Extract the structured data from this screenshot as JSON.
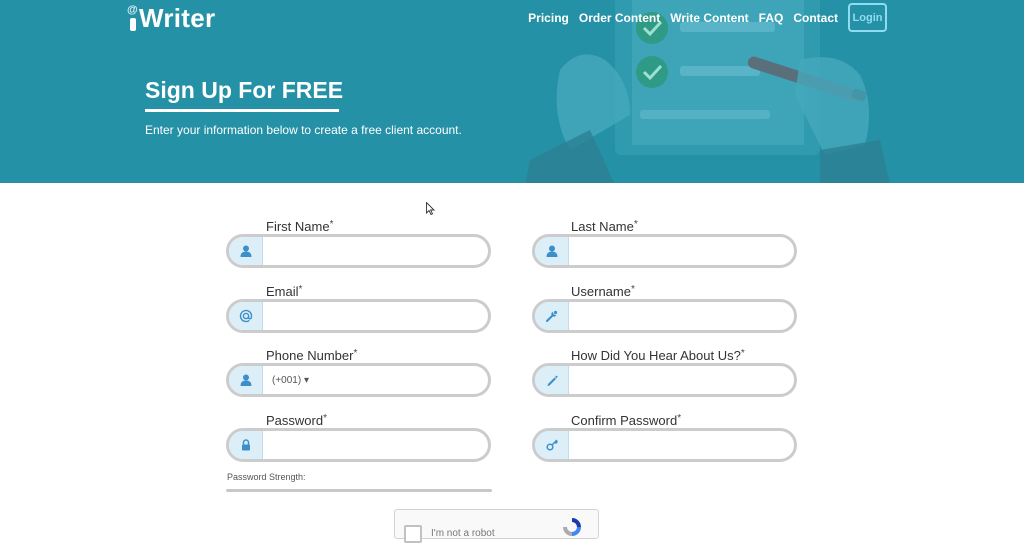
{
  "brand": {
    "logo_at": "@",
    "logo_text": "Writer"
  },
  "nav": {
    "items": [
      "Pricing",
      "Order Content",
      "Write Content",
      "FAQ",
      "Contact"
    ],
    "login": "Login"
  },
  "hero": {
    "title": "Sign Up For FREE",
    "subtitle": "Enter your information below to create a free client account."
  },
  "form": {
    "required_mark": "*",
    "first_name": {
      "label": "First Name",
      "value": "",
      "icon": "user-icon"
    },
    "last_name": {
      "label": "Last Name",
      "value": "",
      "icon": "user-icon"
    },
    "email": {
      "label": "Email",
      "value": "",
      "icon": "at-icon"
    },
    "username": {
      "label": "Username",
      "value": "",
      "icon": "wrench-icon"
    },
    "phone": {
      "label": "Phone Number",
      "code": "(+001)",
      "dropdown": "▾",
      "value": "",
      "icon": "user-icon"
    },
    "hear_about": {
      "label": "How Did You Hear About Us?",
      "value": "",
      "icon": "pen-icon"
    },
    "password": {
      "label": "Password",
      "value": "",
      "icon": "lock-icon"
    },
    "confirm_password": {
      "label": "Confirm Password",
      "value": "",
      "icon": "key-icon"
    },
    "password_strength_label": "Password Strength:",
    "password_strength": 0
  },
  "captcha": {
    "label": "I'm not a robot"
  },
  "colors": {
    "hero_bg": "#2591a6",
    "login_border": "#8fdcf0",
    "field_border": "#cccccc",
    "icon_bg": "#dceef8",
    "icon_color": "#3c8fc8"
  }
}
